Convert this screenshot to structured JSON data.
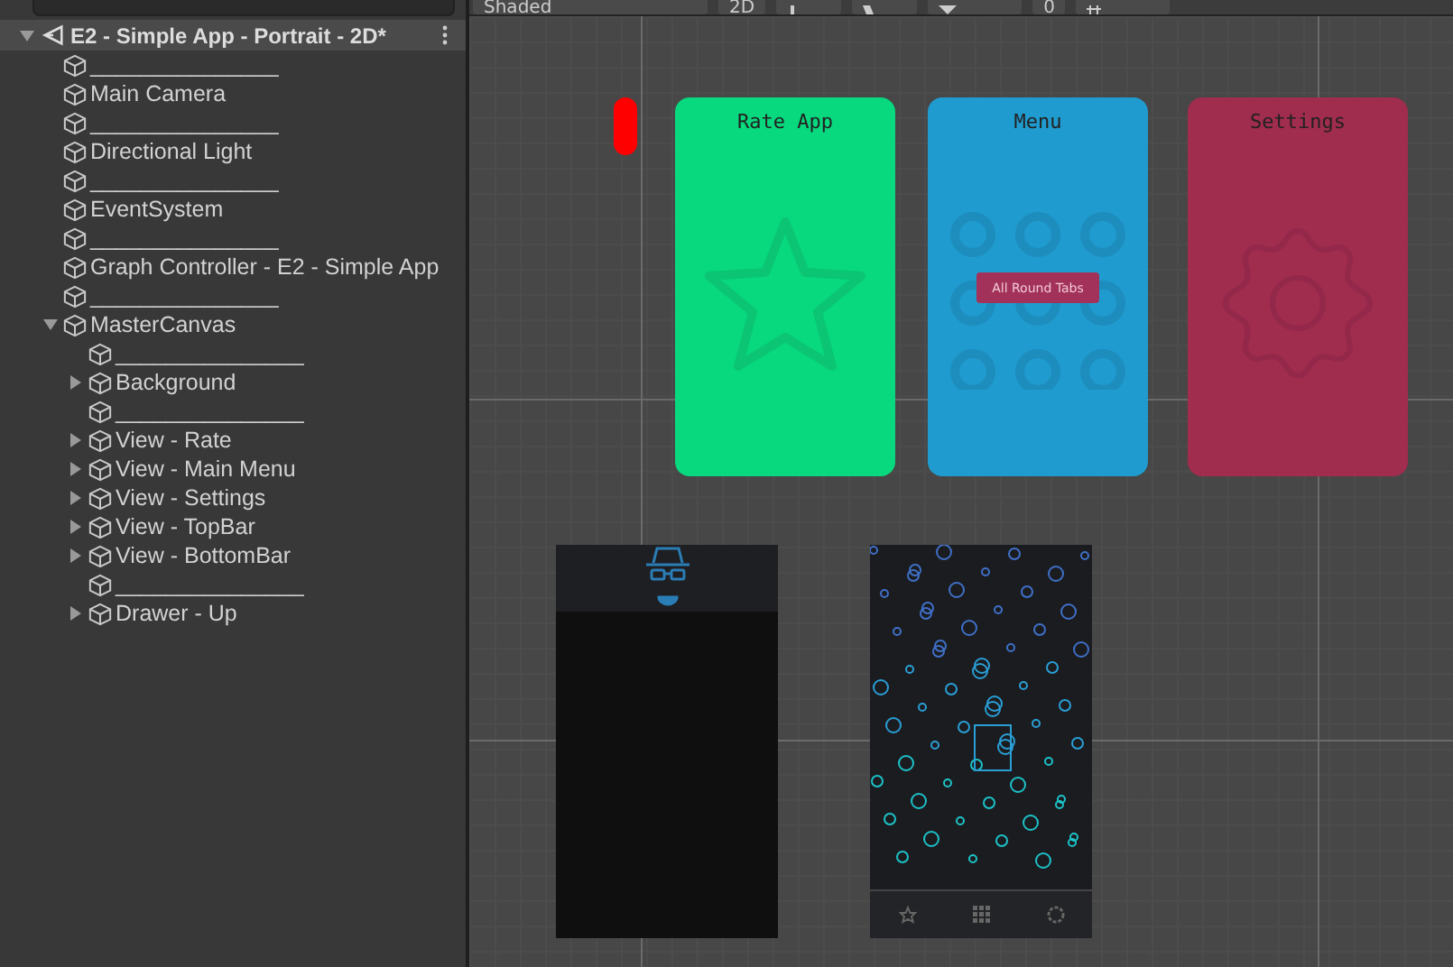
{
  "toolbar": {
    "shading": "Shaded",
    "mode": "2D",
    "gizmo_count": "0"
  },
  "hierarchy": {
    "scene": {
      "title": "E2 - Simple App - Portrait - 2D*",
      "expanded": true
    },
    "items": [
      {
        "label": "_______________"
      },
      {
        "label": "Main Camera"
      },
      {
        "label": "_______________"
      },
      {
        "label": "Directional Light"
      },
      {
        "label": "_______________"
      },
      {
        "label": "EventSystem"
      },
      {
        "label": "_______________"
      },
      {
        "label": "Graph Controller - E2 - Simple App"
      },
      {
        "label": "_______________"
      },
      {
        "label": "MasterCanvas",
        "expanded": true,
        "children": [
          {
            "label": "_______________"
          },
          {
            "label": "Background",
            "expanded": false
          },
          {
            "label": "_______________"
          },
          {
            "label": "View - Rate",
            "expanded": false
          },
          {
            "label": "View - Main Menu",
            "expanded": false
          },
          {
            "label": "View - Settings",
            "expanded": false
          },
          {
            "label": "View - TopBar",
            "expanded": false
          },
          {
            "label": "View - BottomBar",
            "expanded": false
          },
          {
            "label": "_______________"
          },
          {
            "label": "Drawer - Up",
            "expanded": false
          }
        ]
      }
    ]
  },
  "scene": {
    "cards": [
      {
        "kind": "rate",
        "title": "Rate App",
        "color": "#08d87e"
      },
      {
        "kind": "menu",
        "title": "Menu",
        "color": "#209bcf",
        "button": "All Round Tabs"
      },
      {
        "kind": "settings",
        "title": "Settings",
        "color": "#a02c4e"
      }
    ]
  }
}
